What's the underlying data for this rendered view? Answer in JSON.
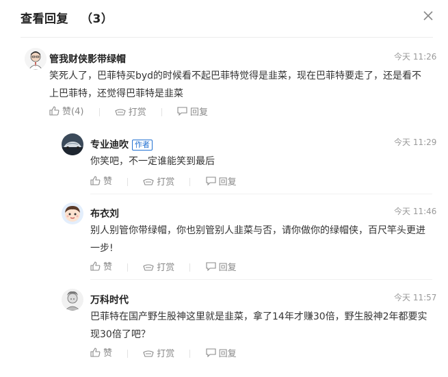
{
  "dialog": {
    "title": "查看回复",
    "count_text": "（3）"
  },
  "main_comment": {
    "author": "管我财侠影带绿帽",
    "time": "今天 11:26",
    "text": "笑死人了，巴菲特买byd的时候看不起巴菲特觉得是韭菜，现在巴菲特要走了，还是看不上巴菲特，还觉得巴菲特是韭菜",
    "like_label": "赞(4)",
    "tip_label": "打赏",
    "reply_label": "回复"
  },
  "replies": [
    {
      "author": "专业迪吹",
      "badge": "作者",
      "time": "今天 11:29",
      "text": "你笑吧，不一定谁能笑到最后",
      "like_label": "赞",
      "tip_label": "打赏",
      "reply_label": "回复"
    },
    {
      "author": "布衣刘",
      "time": "今天 11:46",
      "text": "别人别管你带绿帽，你也别管别人韭菜与否，请你做你的绿帽侠，百尺竿头更进一步!",
      "like_label": "赞",
      "tip_label": "打赏",
      "reply_label": "回复"
    },
    {
      "author": "万科时代",
      "time": "今天 11:57",
      "text": "巴菲特在国产野生股神这里就是韭菜，拿了14年才赚30倍，野生股神2年都要实现30倍了吧？",
      "like_label": "赞",
      "tip_label": "打赏",
      "reply_label": "回复"
    }
  ],
  "icons": {
    "close": "close-icon",
    "like": "thumbs-up-icon",
    "tip": "tip-icon",
    "reply": "comment-icon"
  },
  "colors": {
    "author_badge": "#1f6fd1",
    "muted": "#888888"
  }
}
